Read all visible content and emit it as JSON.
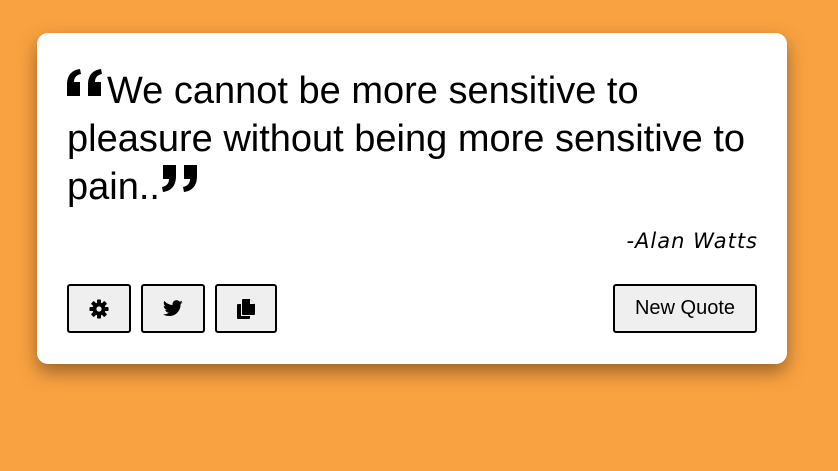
{
  "quote": {
    "text": "We cannot be more sensitive to pleasure without being more sensitive to pain..",
    "author": "-Alan Watts"
  },
  "toolbar": {
    "settings_icon": "gear-icon",
    "twitter_icon": "twitter-icon",
    "copy_icon": "copy-icon",
    "new_quote_label": "New Quote"
  },
  "colors": {
    "background": "#f9a241",
    "card": "#ffffff",
    "button_bg": "#efefef",
    "text": "#000000"
  }
}
